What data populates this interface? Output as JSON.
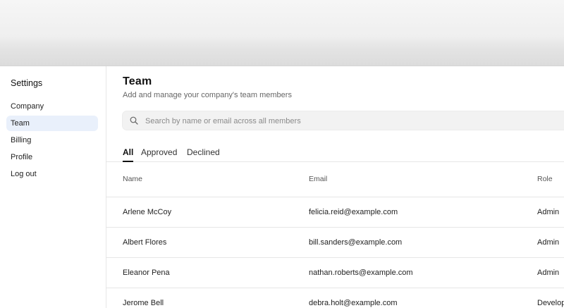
{
  "sidebar": {
    "title": "Settings",
    "items": [
      {
        "label": "Company"
      },
      {
        "label": "Team"
      },
      {
        "label": "Billing"
      },
      {
        "label": "Profile"
      },
      {
        "label": "Log out"
      }
    ],
    "active": "Team"
  },
  "page": {
    "title": "Team",
    "subtitle": "Add and manage your company's team members"
  },
  "search": {
    "placeholder": "Search by name or email across all members",
    "value": "",
    "icon": "search-icon"
  },
  "tabs": [
    {
      "label": "All",
      "active": true
    },
    {
      "label": "Approved",
      "active": false
    },
    {
      "label": "Declined",
      "active": false
    }
  ],
  "table": {
    "headers": {
      "name": "Name",
      "email": "Email",
      "role": "Role"
    },
    "rows": [
      {
        "name": "Arlene McCoy",
        "email": "felicia.reid@example.com",
        "role": "Admin"
      },
      {
        "name": "Albert Flores",
        "email": "bill.sanders@example.com",
        "role": "Admin"
      },
      {
        "name": "Eleanor Pena",
        "email": "nathan.roberts@example.com",
        "role": "Admin"
      },
      {
        "name": "Jerome Bell",
        "email": "debra.holt@example.com",
        "role": "Develop"
      }
    ]
  },
  "colors": {
    "active_nav_bg": "#e9f0fb",
    "divider": "#e6e6e6",
    "search_bg": "#f2f2f2"
  }
}
